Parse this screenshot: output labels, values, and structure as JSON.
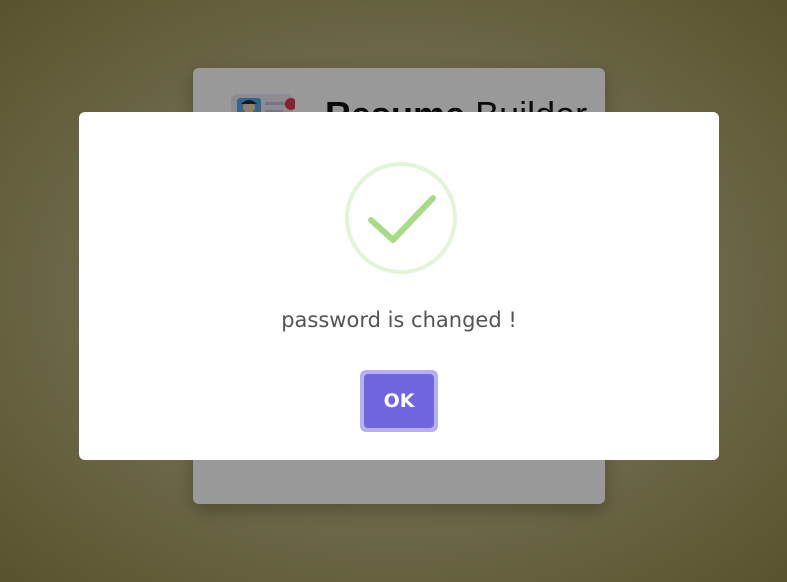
{
  "background_card": {
    "brand_bold": "Resume",
    "brand_rest": " Builder"
  },
  "dialog": {
    "icon": "success-check-icon",
    "message": "password is changed !",
    "ok_label": "OK"
  },
  "colors": {
    "accent": "#7266e0",
    "success": "#a5dc86",
    "overlay": "rgba(0,0,0,0.4)"
  }
}
